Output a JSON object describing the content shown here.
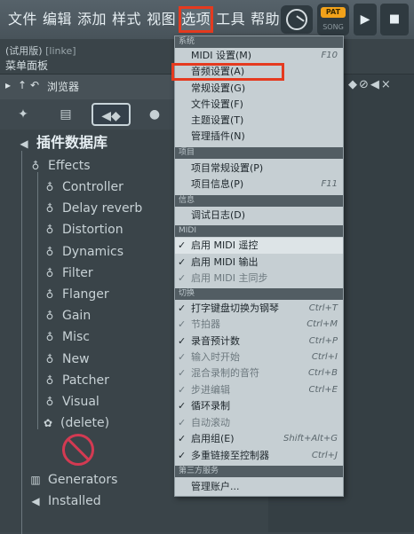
{
  "menubar": {
    "file": "文件",
    "edit": "编辑",
    "add": "添加",
    "style": "样式",
    "view": "视图",
    "options": "选项",
    "tools": "工具",
    "help": "帮助"
  },
  "transport": {
    "pat": "PAT",
    "song": "SONG"
  },
  "hint": {
    "trial": "(试用版)",
    "user": "[linke]",
    "panel": "菜单面板"
  },
  "browser": {
    "title": "浏览器",
    "tree_title": "插件数据库",
    "effects": "Effects",
    "effect_items": [
      "Controller",
      "Delay reverb",
      "Distortion",
      "Dynamics",
      "Filter",
      "Flanger",
      "Gain",
      "Misc",
      "New",
      "Patcher",
      "Visual"
    ],
    "delete": "(delete)",
    "generators": "Generators",
    "installed": "Installed"
  },
  "dropdown": {
    "sections": {
      "system": "系统",
      "project": "项目",
      "info": "信息",
      "midi": "MIDI",
      "toggles": "切换",
      "third_party": "第三方服务"
    },
    "items": {
      "midi_settings": {
        "label": "MIDI 设置(M)",
        "shortcut": "F10"
      },
      "audio_settings": {
        "label": "音频设置(A)"
      },
      "general_settings": {
        "label": "常规设置(G)"
      },
      "file_settings": {
        "label": "文件设置(F)"
      },
      "theme_settings": {
        "label": "主题设置(T)"
      },
      "manage_plugins": {
        "label": "管理插件(N)"
      },
      "project_general": {
        "label": "项目常规设置(P)"
      },
      "project_info": {
        "label": "项目信息(P)",
        "shortcut": "F11"
      },
      "debug_log": {
        "label": "调试日志(D)"
      },
      "midi_remote": {
        "label": "启用 MIDI 遥控",
        "check": "✓"
      },
      "midi_output": {
        "label": "启用 MIDI 输出",
        "check": "✓"
      },
      "midi_master_sync": {
        "label": "启用 MIDI 主同步",
        "check": "✓"
      },
      "typing_keyboard": {
        "label": "打字键盘切换为钢琴",
        "shortcut": "Ctrl+T",
        "check": "✓"
      },
      "metronome": {
        "label": "节拍器",
        "shortcut": "Ctrl+M",
        "check": "✓"
      },
      "record_precount": {
        "label": "录音预计数",
        "shortcut": "Ctrl+P",
        "check": "✓"
      },
      "start_on_input": {
        "label": "输入时开始",
        "shortcut": "Ctrl+I",
        "check": "✓"
      },
      "blend_recording": {
        "label": "混合录制的音符",
        "shortcut": "Ctrl+B",
        "check": "✓"
      },
      "step_edit": {
        "label": "步进编辑",
        "shortcut": "Ctrl+E",
        "check": "✓"
      },
      "loop_record": {
        "label": "循环录制",
        "check": "✓"
      },
      "auto_scroll": {
        "label": "自动滚动",
        "check": "✓"
      },
      "enable_groups": {
        "label": "启用组(E)",
        "shortcut": "Shift+Alt+G",
        "check": "✓"
      },
      "multilink": {
        "label": "多重链接至控制器",
        "shortcut": "Ctrl+J",
        "check": "✓"
      },
      "manage_account": {
        "label": "管理账户..."
      }
    }
  }
}
